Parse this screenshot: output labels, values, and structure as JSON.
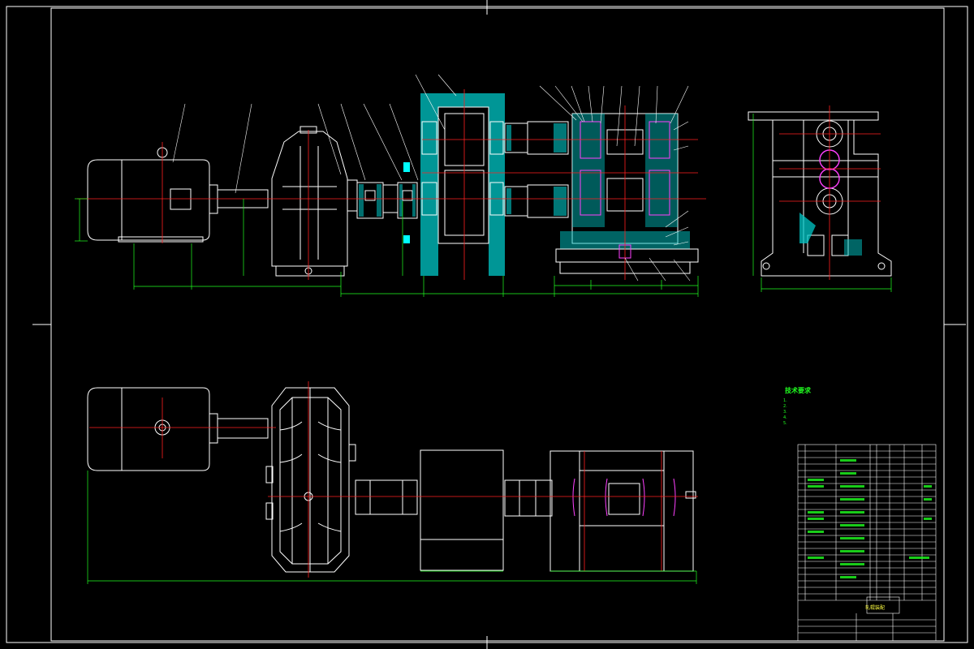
{
  "colors": {
    "background": "#000000",
    "outline": "#ffffff",
    "centerline": "#ff2020",
    "dimension": "#20ff20",
    "leader": "#ffffff",
    "hatch": "#00c8c8",
    "section": "#00ffff",
    "bearing": "#ff40ff",
    "titleblock_text": "#ffff40"
  },
  "technical_requirements": {
    "title": "技术要求",
    "notes": [
      "1.",
      "2.",
      "3.",
      "4.",
      "5."
    ]
  },
  "title_block": {
    "drawing_title": "轧辊装配"
  },
  "icons": [
    "motor",
    "gear-reducer",
    "coupling",
    "gear-stand",
    "roll-stand",
    "side-view-stand"
  ]
}
